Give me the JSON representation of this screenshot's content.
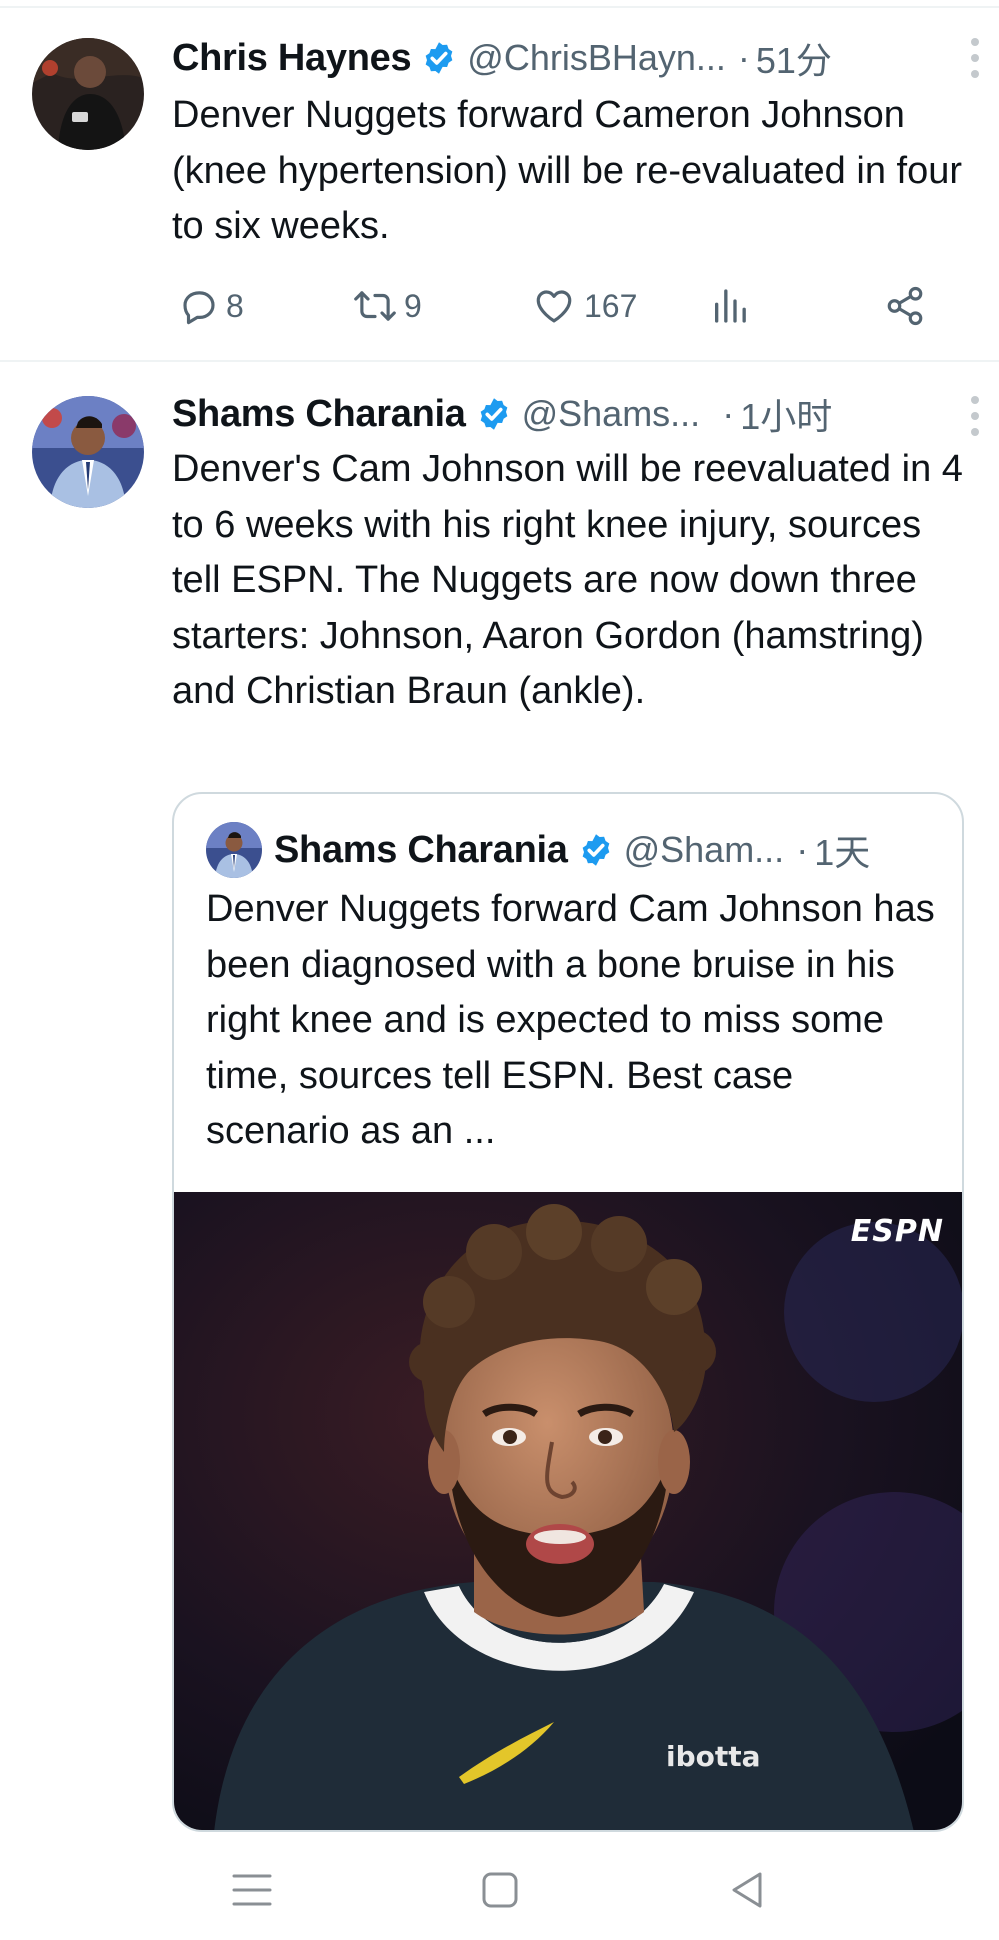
{
  "feed": {
    "tweets": [
      {
        "author_name": "Chris Haynes",
        "handle": "@ChrisBHayn...",
        "time": "51分",
        "text": "Denver Nuggets forward Cameron Johnson (knee hypertension) will be re-evaluated in four to six weeks.",
        "stats": {
          "replies": "8",
          "retweets": "9",
          "likes": "167"
        }
      },
      {
        "author_name": "Shams Charania",
        "handle": "@Shams...",
        "time": "1小时",
        "text": "Denver's Cam Johnson will be reevaluated in 4 to 6 weeks with his right knee injury, sources tell ESPN. The Nuggets are now down three starters: Johnson, Aaron Gordon (hamstring) and Christian Braun (ankle).",
        "quote": {
          "author_name": "Shams Charania",
          "handle": "@Sham...",
          "time": "1天",
          "text": "Denver Nuggets forward Cam Johnson has been diagnosed with a bone bruise in his right knee and is expected to miss some time, sources tell ESPN. Best case scenario as an ...",
          "media": {
            "logo_text": "ESPN",
            "jersey_text": "ibotta"
          }
        }
      }
    ],
    "separator": "·"
  },
  "colors": {
    "text_primary": "#0f1419",
    "text_secondary": "#536471",
    "verified": "#1d9bf0",
    "divider": "#eff3f4"
  },
  "icons": [
    "reply-icon",
    "retweet-icon",
    "like-icon",
    "views-icon",
    "share-icon",
    "verified-icon",
    "more-icon",
    "menu-nav-icon",
    "home-nav-icon",
    "back-nav-icon"
  ]
}
